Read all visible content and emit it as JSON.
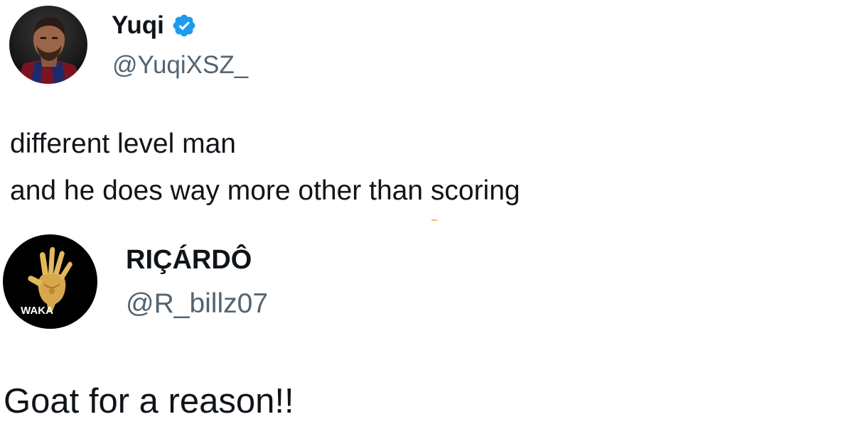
{
  "tweets": [
    {
      "author": {
        "display_name": "Yuqi",
        "handle": "@YuqiXSZ_",
        "verified": true,
        "avatar_icon": "footballer-portrait-avatar"
      },
      "text_lines": [
        "different level man",
        "and he does way more other than scoring"
      ]
    },
    {
      "author": {
        "display_name": "RIÇÁRDÔ",
        "handle": "@R_billz07",
        "verified": false,
        "avatar_icon": "gold-hand-waka-logo",
        "avatar_caption": "WAKA"
      },
      "text_lines": [
        "Goat for a reason!!"
      ]
    }
  ],
  "colors": {
    "name": "#0f1419",
    "handle": "#536471",
    "verified_badge": "#1d9bf0",
    "background": "#ffffff"
  }
}
